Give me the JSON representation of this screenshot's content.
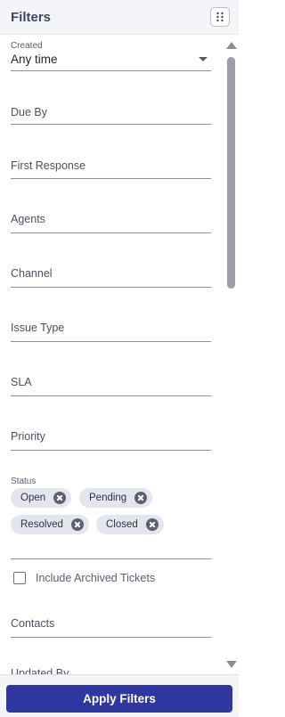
{
  "header": {
    "title": "Filters",
    "menu_icon": "grid-dots-icon"
  },
  "filters": {
    "created": {
      "label": "Created",
      "value": "Any time"
    },
    "due_by": "Due By",
    "first_response": "First Response",
    "agents": "Agents",
    "channel": "Channel",
    "issue_type": "Issue Type",
    "sla": "SLA",
    "priority": "Priority",
    "status": {
      "label": "Status",
      "chips": [
        "Open",
        "Pending",
        "Resolved",
        "Closed"
      ]
    },
    "include_archived": {
      "label": "Include Archived Tickets",
      "checked": false
    },
    "contacts": "Contacts",
    "updated_by": "Updated By"
  },
  "footer": {
    "apply_label": "Apply Filters"
  },
  "colors": {
    "accent": "#2f37a3",
    "chip_bg": "#e4e6ee",
    "header_bg": "#f4f5f8"
  }
}
